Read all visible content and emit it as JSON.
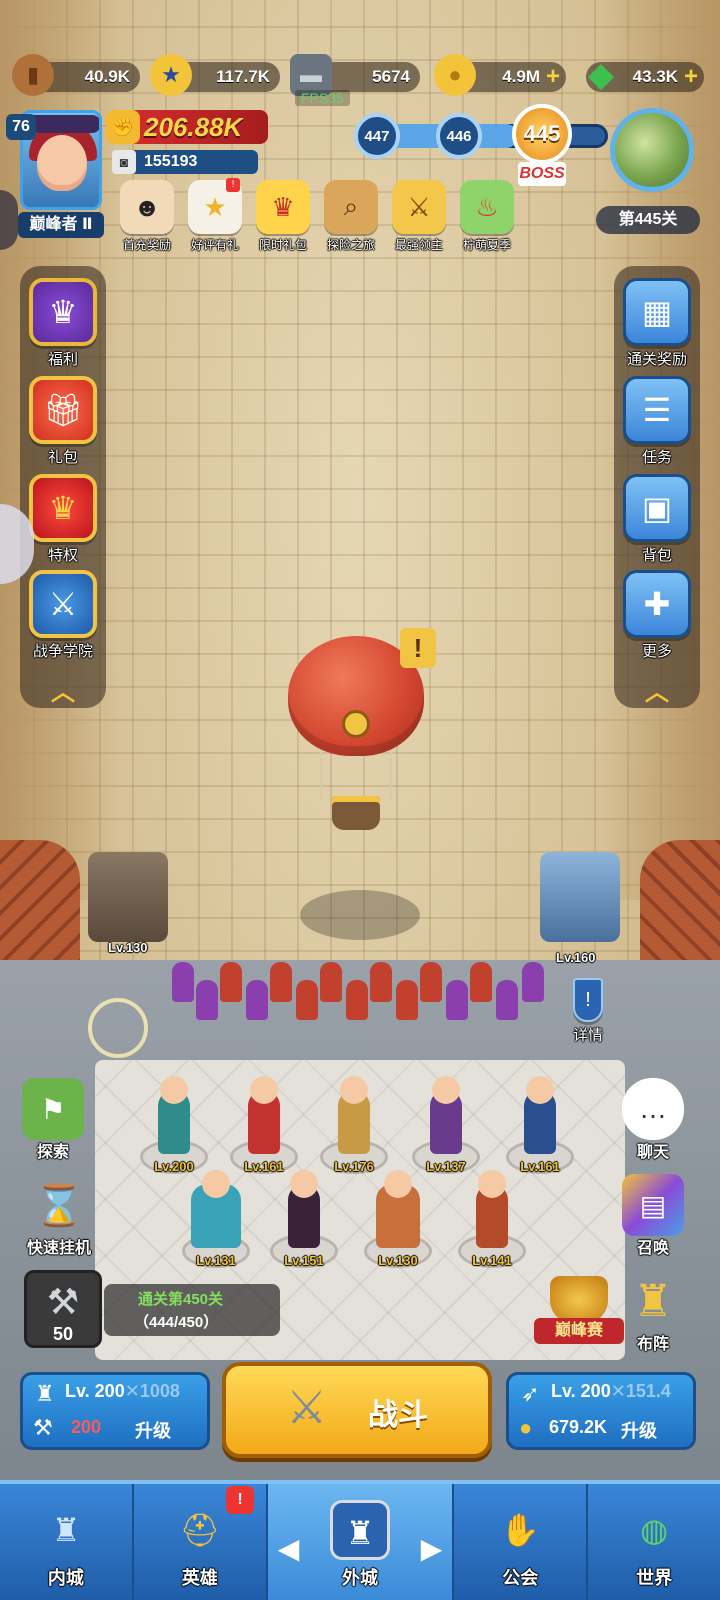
{
  "resources": [
    {
      "name": "wood-icon",
      "value": "40.9K",
      "color": "#b0703a"
    },
    {
      "name": "star-coin-icon",
      "value": "117.7K",
      "color": "#f3c43a"
    },
    {
      "name": "iron-icon",
      "value": "5674",
      "color": "#6b7580"
    },
    {
      "name": "gold-coin-icon",
      "value": "4.9M",
      "color": "#f3c43a"
    },
    {
      "name": "gem-icon",
      "value": "43.3K",
      "color": "#3ec04f"
    }
  ],
  "fps": "FPS35",
  "player": {
    "level": "76",
    "rank": "巅峰者 Ⅱ",
    "power": "206.88K",
    "id": "155193"
  },
  "events": [
    {
      "label": "首充奖励"
    },
    {
      "label": "好评有礼",
      "badge": "!"
    },
    {
      "label": "限时礼包"
    },
    {
      "label": "探险之旅"
    },
    {
      "label": "最强领主"
    },
    {
      "label": "柠萌夏季"
    }
  ],
  "stage": {
    "prev2": "447",
    "prev1": "446",
    "current": "445",
    "boss_tag": "BOSS",
    "label": "第445关"
  },
  "left_menu": [
    {
      "label": "福利"
    },
    {
      "label": "礼包"
    },
    {
      "label": "特权"
    },
    {
      "label": "战争学院"
    }
  ],
  "right_menu": [
    {
      "label": "通关奖励"
    },
    {
      "label": "任务"
    },
    {
      "label": "背包"
    },
    {
      "label": "更多"
    }
  ],
  "balloon_alert": "!",
  "towers": {
    "left_level": "Lv.130",
    "right_level": "Lv.160",
    "detail_label": "详情"
  },
  "heroes": [
    {
      "level": "Lv.200"
    },
    {
      "level": "Lv.161"
    },
    {
      "level": "Lv.176"
    },
    {
      "level": "Lv.137"
    },
    {
      "level": "Lv.161"
    },
    {
      "level": "Lv.131"
    },
    {
      "level": "Lv.151"
    },
    {
      "level": "Lv.130"
    },
    {
      "level": "Lv.141"
    }
  ],
  "lower_left": [
    {
      "label": "探索"
    },
    {
      "label": "快速挂机"
    }
  ],
  "lower_right": [
    {
      "label": "聊天"
    },
    {
      "label": "召唤"
    },
    {
      "label": "布阵"
    }
  ],
  "hammer_count": "50",
  "clear": {
    "title": "通关第450关",
    "progress": "（444/450）"
  },
  "peak_label": "巅峰赛",
  "castle_upgrade": {
    "level": "Lv. 200",
    "extra": "1008",
    "cost": "200",
    "action": "升级"
  },
  "fight_label": "战斗",
  "bow_upgrade": {
    "level": "Lv. 200",
    "extra": "151.4",
    "cost": "679.2K",
    "action": "升级"
  },
  "nav": [
    {
      "label": "内城"
    },
    {
      "label": "英雄",
      "badge": "!"
    },
    {
      "label": "外城"
    },
    {
      "label": "公会"
    },
    {
      "label": "世界"
    }
  ]
}
